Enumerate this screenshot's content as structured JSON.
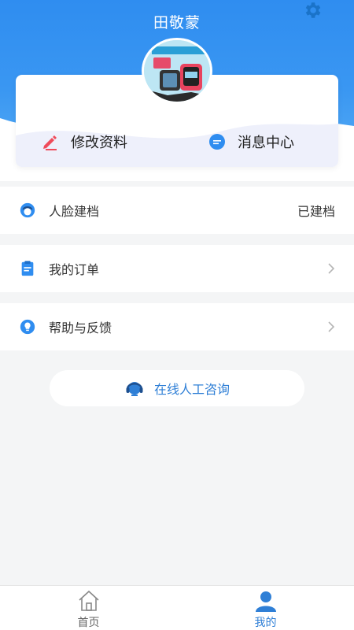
{
  "profile": {
    "name": "田敬蒙"
  },
  "actions": {
    "edit_label": "修改资料",
    "message_label": "消息中心"
  },
  "menu": [
    {
      "label": "人脸建档",
      "value": "已建档",
      "icon": "face-profile-icon"
    },
    {
      "label": "我的订单",
      "icon": "clipboard-icon"
    },
    {
      "label": "帮助与反馈",
      "icon": "lightbulb-icon"
    }
  ],
  "consult": {
    "label": "在线人工咨询",
    "icon": "headset-icon"
  },
  "tabbar": {
    "home_label": "首页",
    "mine_label": "我的",
    "active": "我的"
  },
  "colors": {
    "primary": "#2f8df0",
    "accent_red": "#ef4b5b",
    "text": "#333333",
    "background": "#f4f5f6"
  }
}
